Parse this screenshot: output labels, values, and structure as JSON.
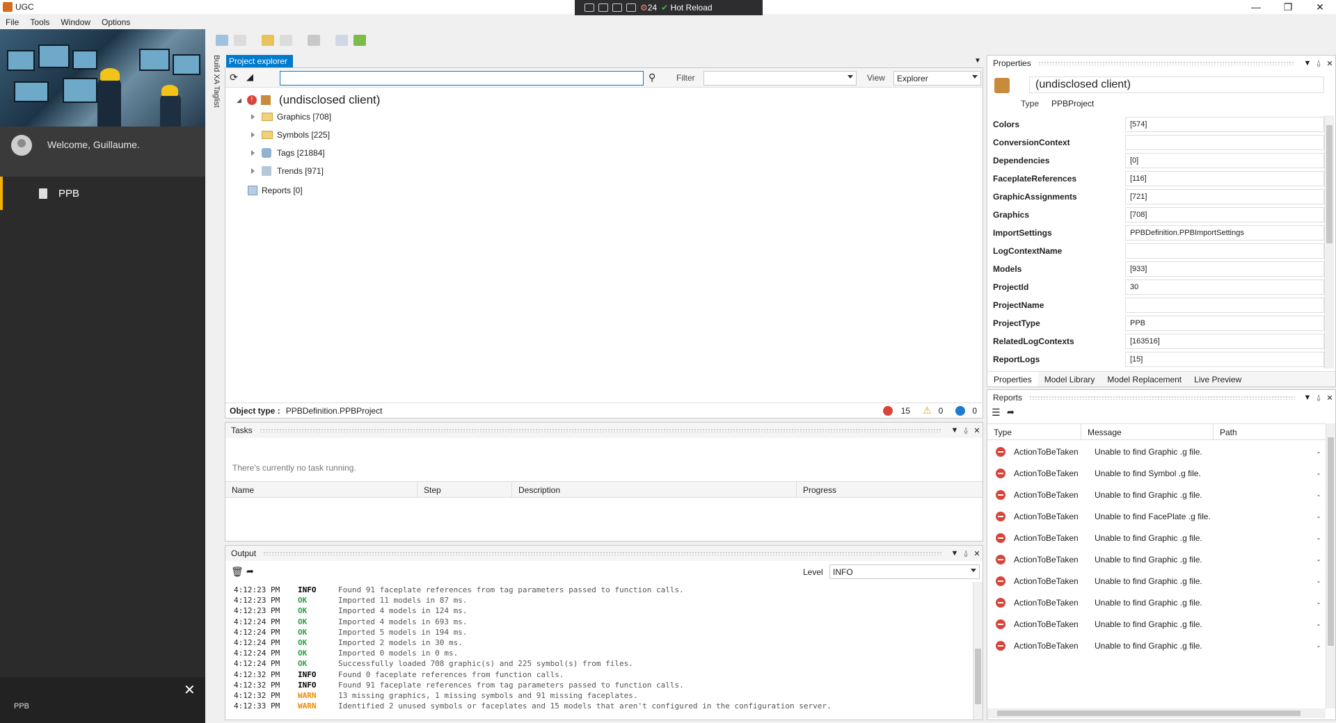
{
  "window": {
    "title": "UGC"
  },
  "hotreload_toolbar": {
    "count": "24",
    "label": "Hot Reload"
  },
  "menu": [
    "File",
    "Tools",
    "Window",
    "Options"
  ],
  "sidebar": {
    "welcome": "Welcome, Guillaume.",
    "nav_item": "PPB",
    "footer_label": "PPB",
    "vertical_tab": "Build XA Taglist"
  },
  "project_explorer": {
    "tab": "Project explorer",
    "search": {
      "value": "",
      "placeholder": ""
    },
    "filter_label": "Filter",
    "filter_value": "",
    "view_label": "View",
    "view_value": "Explorer",
    "root": "(undisclosed client)",
    "children": [
      "Graphics [708]",
      "Symbols [225]",
      "Tags [21884]",
      "Trends [971]"
    ],
    "reports": "Reports [0]",
    "object_type_label": "Object type :",
    "object_type_value": "PPBDefinition.PPBProject",
    "counts": {
      "errors": "15",
      "warnings": "0",
      "infos": "0"
    }
  },
  "tasks": {
    "title": "Tasks",
    "empty_message": "There's currently no task running.",
    "columns": [
      "Name",
      "Step",
      "Description",
      "Progress"
    ]
  },
  "output": {
    "title": "Output",
    "level_label": "Level",
    "level_value": "INFO",
    "colors": {
      "INFO": "#000000",
      "OK": "#2ea043",
      "WARN": "#f08a00"
    },
    "lines": [
      {
        "time": "4:12:23 PM",
        "level": "INFO",
        "msg": "Found 91 faceplate references from tag parameters passed to function calls."
      },
      {
        "time": "4:12:23 PM",
        "level": "OK",
        "msg": "Imported 11 models in 87 ms."
      },
      {
        "time": "4:12:23 PM",
        "level": "OK",
        "msg": "Imported 4 models in 124 ms."
      },
      {
        "time": "4:12:24 PM",
        "level": "OK",
        "msg": "Imported 4 models in 693 ms."
      },
      {
        "time": "4:12:24 PM",
        "level": "OK",
        "msg": "Imported 5 models in 194 ms."
      },
      {
        "time": "4:12:24 PM",
        "level": "OK",
        "msg": "Imported 2 models in 30 ms."
      },
      {
        "time": "4:12:24 PM",
        "level": "OK",
        "msg": "Imported 0 models in 0 ms."
      },
      {
        "time": "4:12:24 PM",
        "level": "OK",
        "msg": "Successfully loaded 708 graphic(s) and 225 symbol(s) from files."
      },
      {
        "time": "4:12:32 PM",
        "level": "INFO",
        "msg": "Found 0 faceplate references from function calls."
      },
      {
        "time": "4:12:32 PM",
        "level": "INFO",
        "msg": "Found 91 faceplate references from tag parameters passed to function calls."
      },
      {
        "time": "4:12:32 PM",
        "level": "WARN",
        "msg": "13 missing graphics, 1 missing symbols and 91 missing faceplates."
      },
      {
        "time": "4:12:33 PM",
        "level": "WARN",
        "msg": "Identified 2 unused symbols or faceplates and 15 models that aren't configured in the configuration server."
      }
    ]
  },
  "properties": {
    "title": "Properties",
    "name": "(undisclosed client)",
    "type_label": "Type",
    "type_value": "PPBProject",
    "rows": [
      {
        "key": "Colors",
        "value": "[574]"
      },
      {
        "key": "ConversionContext",
        "value": ""
      },
      {
        "key": "Dependencies",
        "value": "[0]"
      },
      {
        "key": "FaceplateReferences",
        "value": "[116]"
      },
      {
        "key": "GraphicAssignments",
        "value": "[721]"
      },
      {
        "key": "Graphics",
        "value": "[708]"
      },
      {
        "key": "ImportSettings",
        "value": "PPBDefinition.PPBImportSettings"
      },
      {
        "key": "LogContextName",
        "value": ""
      },
      {
        "key": "Models",
        "value": "[933]"
      },
      {
        "key": "ProjectId",
        "value": "30"
      },
      {
        "key": "ProjectName",
        "value": ""
      },
      {
        "key": "ProjectType",
        "value": "PPB"
      },
      {
        "key": "RelatedLogContexts",
        "value": "[163516]"
      },
      {
        "key": "ReportLogs",
        "value": "[15]"
      }
    ],
    "tabs": [
      "Properties",
      "Model Library",
      "Model Replacement",
      "Live Preview"
    ]
  },
  "reports": {
    "title": "Reports",
    "columns": [
      "Type",
      "Message",
      "Path"
    ],
    "rows": [
      {
        "type": "ActionToBeTaken",
        "message": "Unable to find Graphic .g file.",
        "path": "-"
      },
      {
        "type": "ActionToBeTaken",
        "message": "Unable to find Symbol .g file.",
        "path": "-"
      },
      {
        "type": "ActionToBeTaken",
        "message": "Unable to find Graphic .g file.",
        "path": "-"
      },
      {
        "type": "ActionToBeTaken",
        "message": "Unable to find FacePlate .g file.",
        "path": "-"
      },
      {
        "type": "ActionToBeTaken",
        "message": "Unable to find Graphic .g file.",
        "path": "-"
      },
      {
        "type": "ActionToBeTaken",
        "message": "Unable to find Graphic .g file.",
        "path": "-"
      },
      {
        "type": "ActionToBeTaken",
        "message": "Unable to find Graphic .g file.",
        "path": "-"
      },
      {
        "type": "ActionToBeTaken",
        "message": "Unable to find Graphic .g file.",
        "path": "-"
      },
      {
        "type": "ActionToBeTaken",
        "message": "Unable to find Graphic .g file.",
        "path": "-"
      },
      {
        "type": "ActionToBeTaken",
        "message": "Unable to find Graphic .g file.",
        "path": "-"
      }
    ]
  }
}
